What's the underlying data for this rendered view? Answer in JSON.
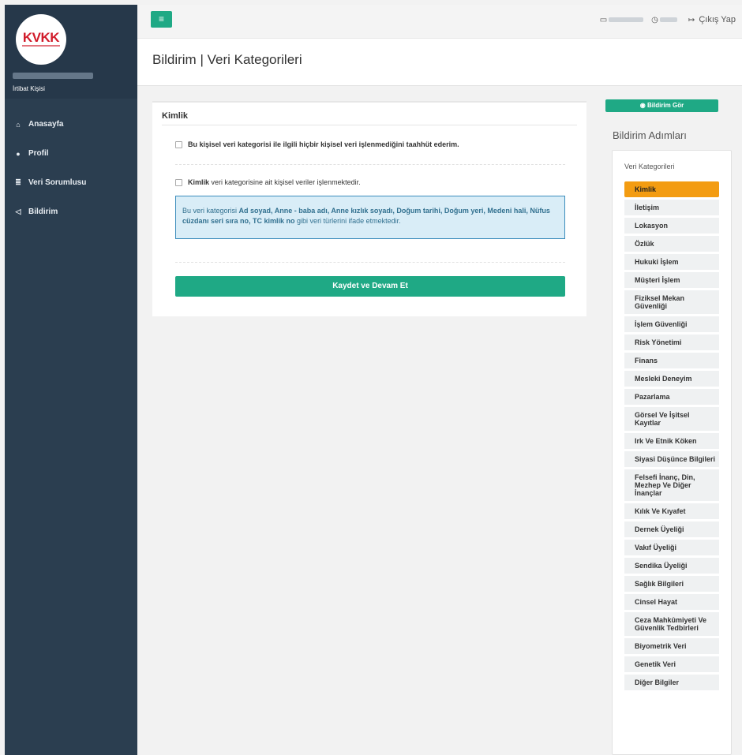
{
  "sidebar": {
    "logo_text": "KVKK",
    "user_role": "İrtibat Kişisi",
    "nav": [
      {
        "icon": "home-icon",
        "glyph": "⌂",
        "label": "Anasayfa"
      },
      {
        "icon": "user-icon",
        "glyph": "●",
        "label": "Profil"
      },
      {
        "icon": "database-icon",
        "glyph": "≣",
        "label": "Veri Sorumlusu"
      },
      {
        "icon": "bullhorn-icon",
        "glyph": "◁",
        "label": "Bildirim"
      }
    ]
  },
  "topbar": {
    "menu_glyph": "≡",
    "calendar_glyph": "▭",
    "clock_glyph": "◷",
    "logout_glyph": "↦",
    "logout_label": "Çıkış Yap"
  },
  "page": {
    "title": "Bildirim | Veri Kategorileri"
  },
  "panel": {
    "title": "Kimlik",
    "no_processing_label": "Bu kişisel veri kategorisi ile ilgili hiçbir kişisel veri işlenmediğini taahhüt ederim.",
    "category_name": "Kimlik",
    "processing_label": " veri kategorisine ait kişisel veriler işlenmektedir.",
    "info_prefix": "Bu veri kategorisi ",
    "info_items": "Ad soyad, Anne - baba adı, Anne kızlık soyadı, Doğum tarihi, Doğum yeri, Medeni hali, Nüfus cüzdanı seri sıra no, TC kimlik no",
    "info_suffix": " gibi veri türlerini ifade etmektedir.",
    "save_label": "Kaydet ve Devam Et"
  },
  "right": {
    "view_label": "Bildirim Gör",
    "steps_title": "Bildirim Adımları",
    "steps_subtitle": "Veri Kategorileri",
    "steps": [
      "Kimlik",
      "İletişim",
      "Lokasyon",
      "Özlük",
      "Hukuki İşlem",
      "Müşteri İşlem",
      "Fiziksel Mekan Güvenliği",
      "İşlem Güvenliği",
      "Risk Yönetimi",
      "Finans",
      "Mesleki Deneyim",
      "Pazarlama",
      "Görsel Ve İşitsel Kayıtlar",
      "Irk Ve Etnik Köken",
      "Siyasi Düşünce Bilgileri",
      "Felsefi İnanç, Din, Mezhep Ve Diğer İnançlar",
      "Kılık Ve Kıyafet",
      "Dernek Üyeliği",
      "Vakıf Üyeliği",
      "Sendika Üyeliği",
      "Sağlık Bilgileri",
      "Cinsel Hayat",
      "Ceza Mahkûmiyeti Ve Güvenlik Tedbirleri",
      "Biyometrik Veri",
      "Genetik Veri",
      "Diğer Bilgiler"
    ],
    "active_step": 0
  },
  "colors": {
    "accent": "#1fa985",
    "sidebar": "#2b3e50",
    "active_step": "#f39c12",
    "info_bg": "#d9edf7"
  }
}
